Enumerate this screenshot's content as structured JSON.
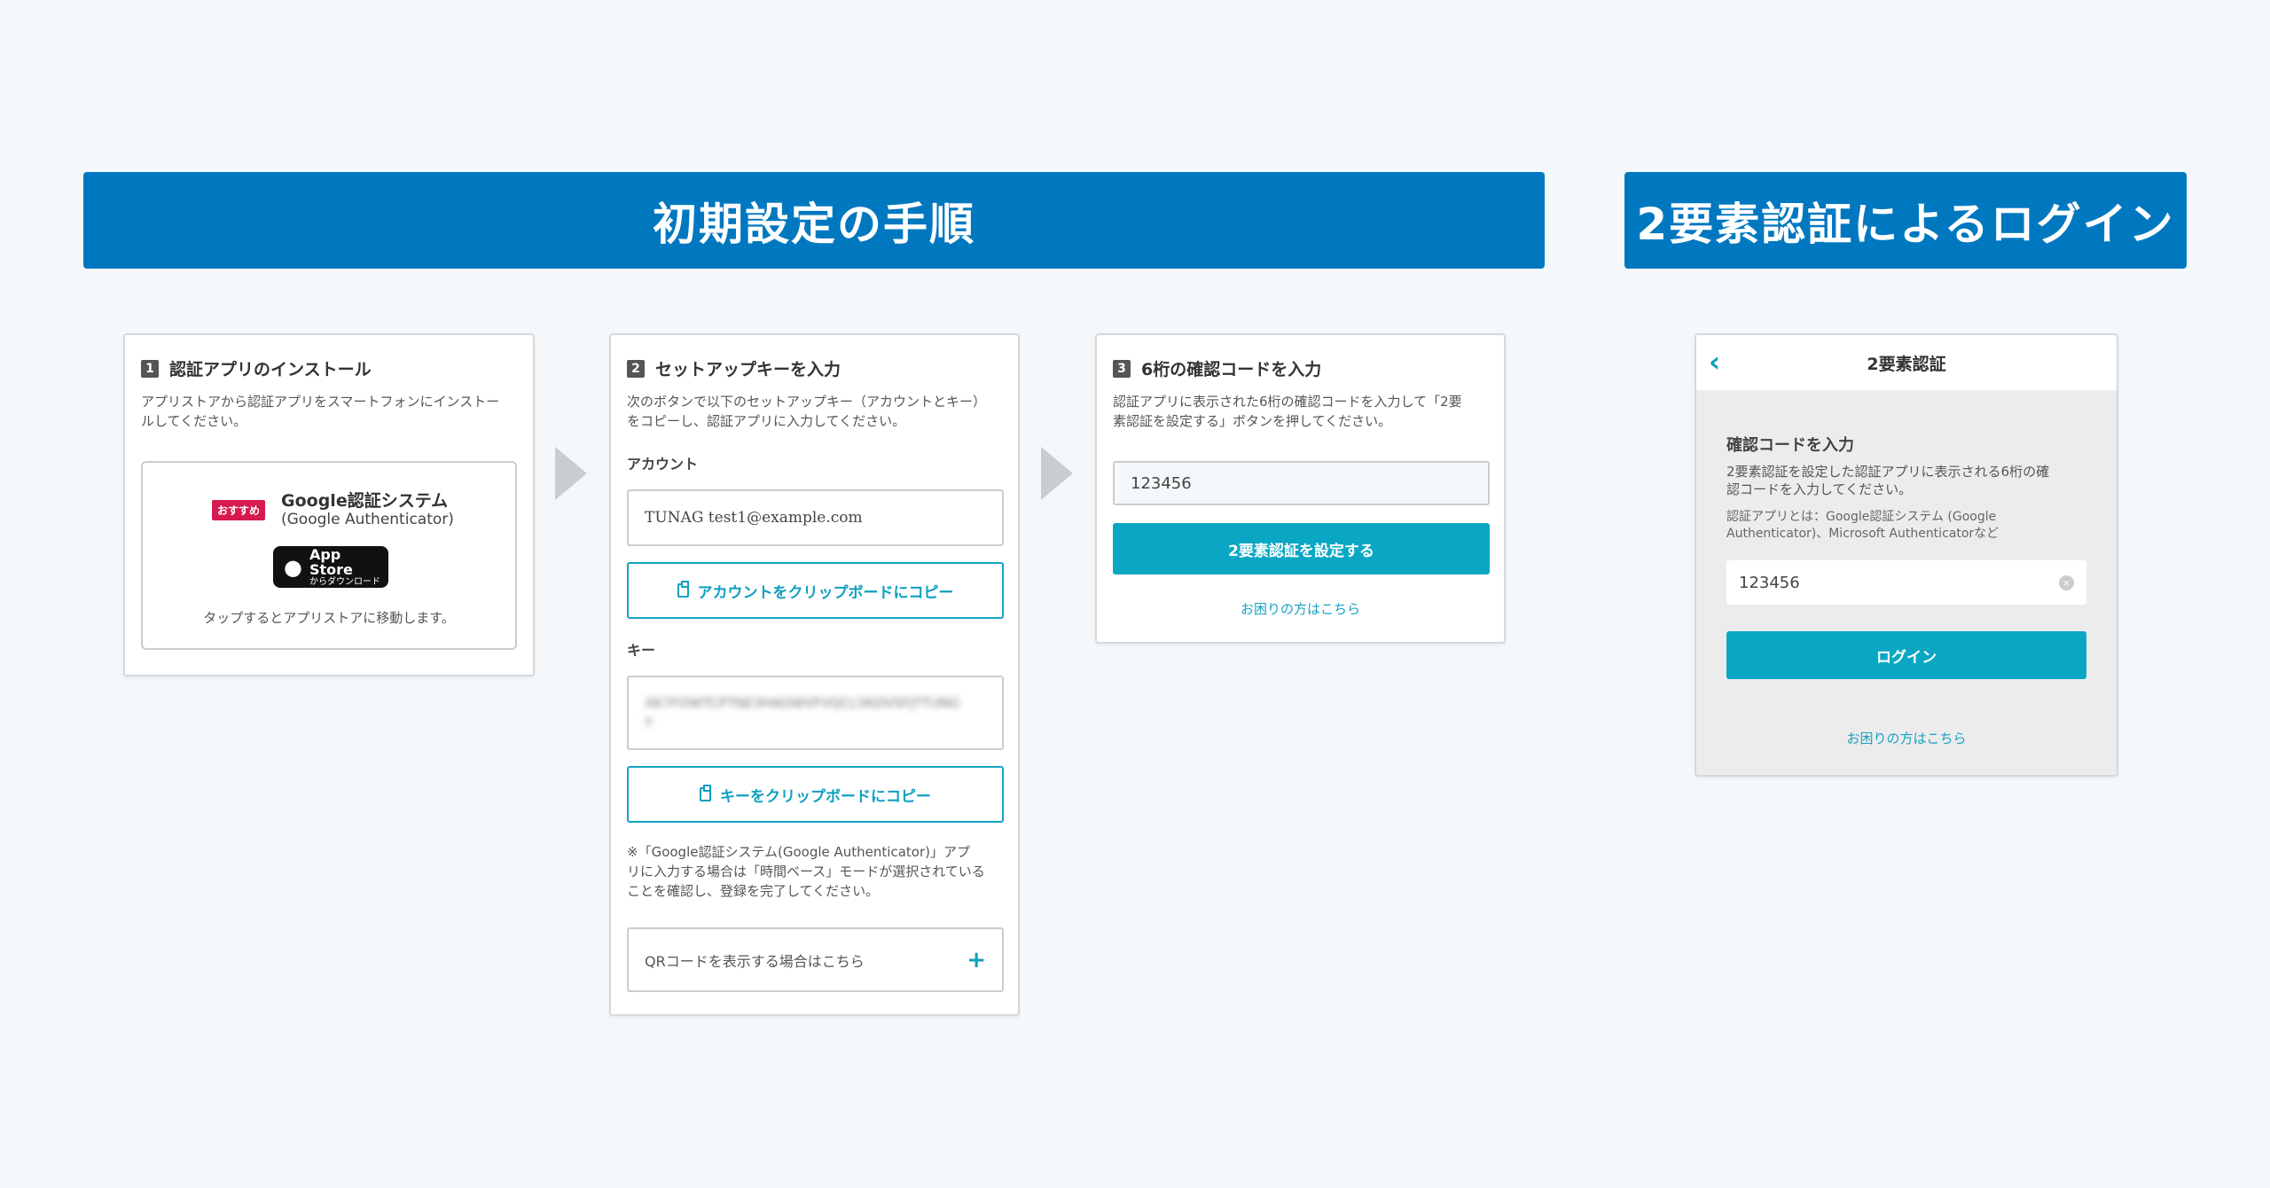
{
  "banners": {
    "setup": "初期設定の手順",
    "login": "2要素認証によるログイン"
  },
  "step1": {
    "num": "1",
    "title": "認証アプリのインストール",
    "desc_line1": "アプリストアから認証アプリをスマートフォンにインストー",
    "desc_line2": "ルしてください。",
    "badge": "おすすめ",
    "app_name": "Google認証システム",
    "app_sub": "(Google Authenticator)",
    "store_title": "App Store",
    "store_sub": "からダウンロード",
    "store_note": "タップするとアプリストアに移動します。"
  },
  "step2": {
    "num": "2",
    "title": "セットアップキーを入力",
    "desc_line1": "次のボタンで以下のセットアップキー（アカウントとキー）",
    "desc_line2": "をコピーし、認証アプリに入力してください。",
    "account_label": "アカウント",
    "account_value": "TUNAG test1@example.com",
    "copy_account": "アカウントをクリップボードにコピー",
    "key_label": "キー",
    "key_value": "XK7FOWTCPTNE3HAOWVFVQCL5KDVSFJTTUNGY",
    "copy_key": "キーをクリップボードにコピー",
    "note_line1": "※「Google認証システム(Google Authenticator)」アプ",
    "note_line2": "リに入力する場合は「時間ベース」モードが選択されている",
    "note_line3": "ことを確認し、登録を完了してください。",
    "qr_label": "QRコードを表示する場合はこちら",
    "qr_icon": "+"
  },
  "step3": {
    "num": "3",
    "title": "6桁の確認コードを入力",
    "desc_line1": "認証アプリに表示された6桁の確認コードを入力して「2要",
    "desc_line2": "素認証を設定する」ボタンを押してください。",
    "code_value": "123456",
    "submit": "2要素認証を設定する",
    "help": "お困りの方はこちら"
  },
  "login": {
    "back_icon": "‹",
    "header": "2要素認証",
    "title": "確認コードを入力",
    "desc_line1": "2要素認証を設定した認証アプリに表示される6桁の確",
    "desc_line2": "認コードを入力してください。",
    "desc2_line1": "認証アプリとは：Google認証システム (Google",
    "desc2_line2": "Authenticator)、Microsoft Authenticatorなど",
    "code_value": "123456",
    "clear_icon": "×",
    "submit": "ログイン",
    "help": "お困りの方はこちら"
  },
  "colors": {
    "banner": "#0078c0",
    "accent": "#0aa7c4",
    "badge": "#d6194e"
  }
}
